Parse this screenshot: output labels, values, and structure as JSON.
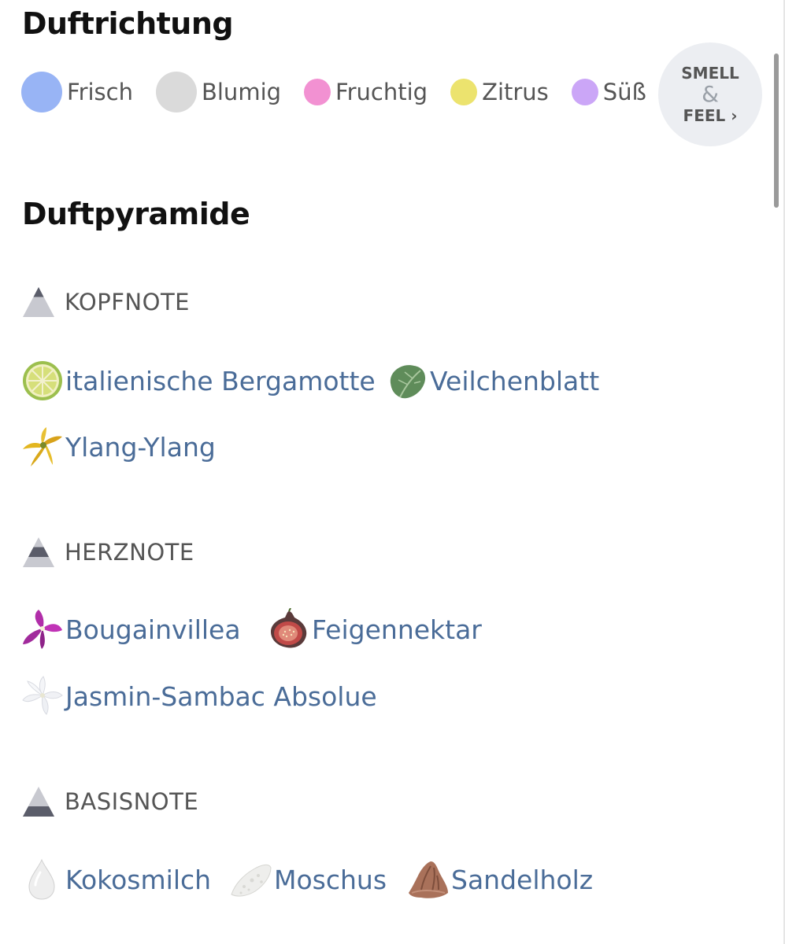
{
  "duftrichtung": {
    "title": "Duftrichtung",
    "chips": [
      {
        "label": "Frisch",
        "color": "#98b4f5",
        "icon": "frisch-dot-icon"
      },
      {
        "label": "Blumig",
        "color": "#dadada",
        "icon": "blumig-dot-icon"
      },
      {
        "label": "Fruchtig",
        "color": "#f291d2",
        "icon": "fruchtig-dot-icon"
      },
      {
        "label": "Zitrus",
        "color": "#ece36e",
        "icon": "zitrus-dot-icon"
      },
      {
        "label": "Süß",
        "color": "#cba6f7",
        "icon": "suess-dot-icon"
      }
    ],
    "smell_feel": {
      "line1": "SMELL",
      "amp": "&",
      "line2": "FEEL ›"
    }
  },
  "duftpyramide": {
    "title": "Duftpyramide",
    "kopfnote": {
      "label": "KOPFNOTE",
      "ingredients": [
        {
          "label": "italienische Bergamotte",
          "icon": "bergamot-slice-icon"
        },
        {
          "label": "Veilchenblatt",
          "icon": "violet-leaf-icon"
        },
        {
          "label": "Ylang-Ylang",
          "icon": "ylang-flower-icon"
        }
      ]
    },
    "herznote": {
      "label": "HERZNOTE",
      "ingredients": [
        {
          "label": "Bougainvillea",
          "icon": "bougainvillea-flower-icon"
        },
        {
          "label": "Feigennektar",
          "icon": "fig-icon"
        },
        {
          "label": "Jasmin-Sambac Absolue",
          "icon": "jasmine-flower-icon"
        }
      ]
    },
    "basisnote": {
      "label": "BASISNOTE",
      "ingredients": [
        {
          "label": "Kokosmilch",
          "icon": "milk-drop-icon"
        },
        {
          "label": "Moschus",
          "icon": "musk-powder-icon"
        },
        {
          "label": "Sandelholz",
          "icon": "sandalwood-icon"
        }
      ]
    }
  }
}
